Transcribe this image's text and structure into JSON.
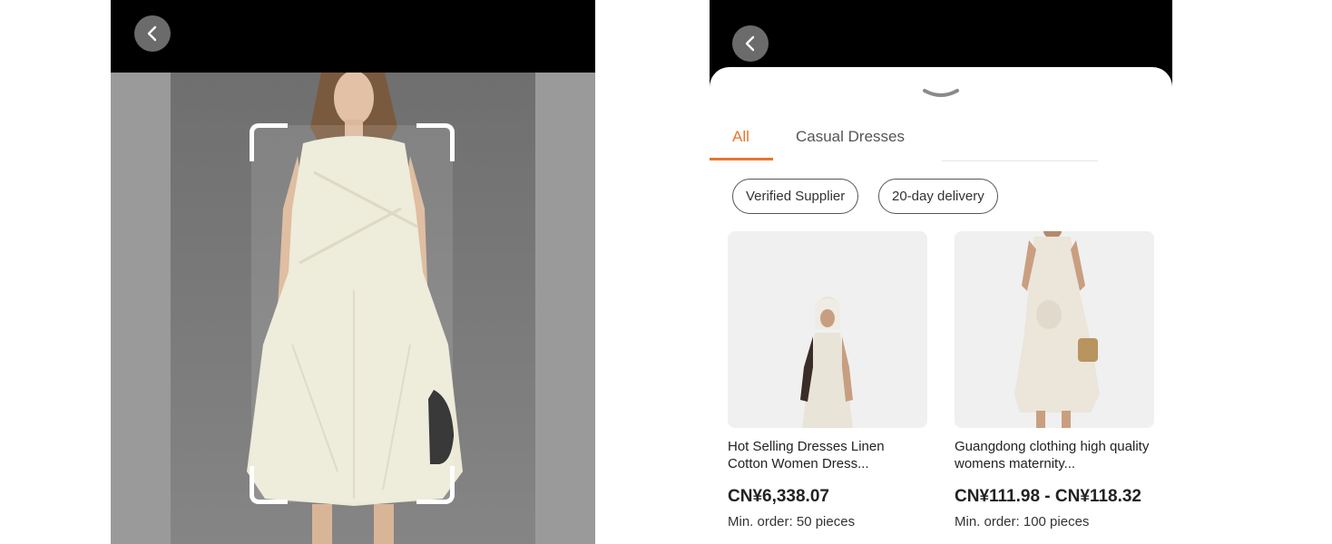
{
  "left_screen": {
    "back_icon": "chevron-left-icon",
    "photo": "woman-in-cream-sleeveless-dress-photo",
    "crop_frame": "image-crop-frame"
  },
  "right_screen": {
    "back_icon": "chevron-left-icon",
    "sheet_handle_icon": "chevron-down-icon",
    "tabs": [
      {
        "label": "All",
        "active": true
      },
      {
        "label": "Casual Dresses",
        "active": false
      }
    ],
    "filters": [
      {
        "label": "Verified Supplier"
      },
      {
        "label": "20-day delivery"
      }
    ],
    "products": [
      {
        "title": "Hot Selling Dresses Linen Cotton Women Dress...",
        "price": "CN¥6,338.07",
        "min_order": "Min. order: 50 pieces"
      },
      {
        "title": "Guangdong clothing high quality womens maternity...",
        "price": "CN¥111.98 - CN¥118.32",
        "min_order": "Min. order: 100 pieces"
      }
    ],
    "colors": {
      "accent": "#e8762d",
      "sheet": "#ffffff",
      "top_bar": "#000000"
    }
  }
}
